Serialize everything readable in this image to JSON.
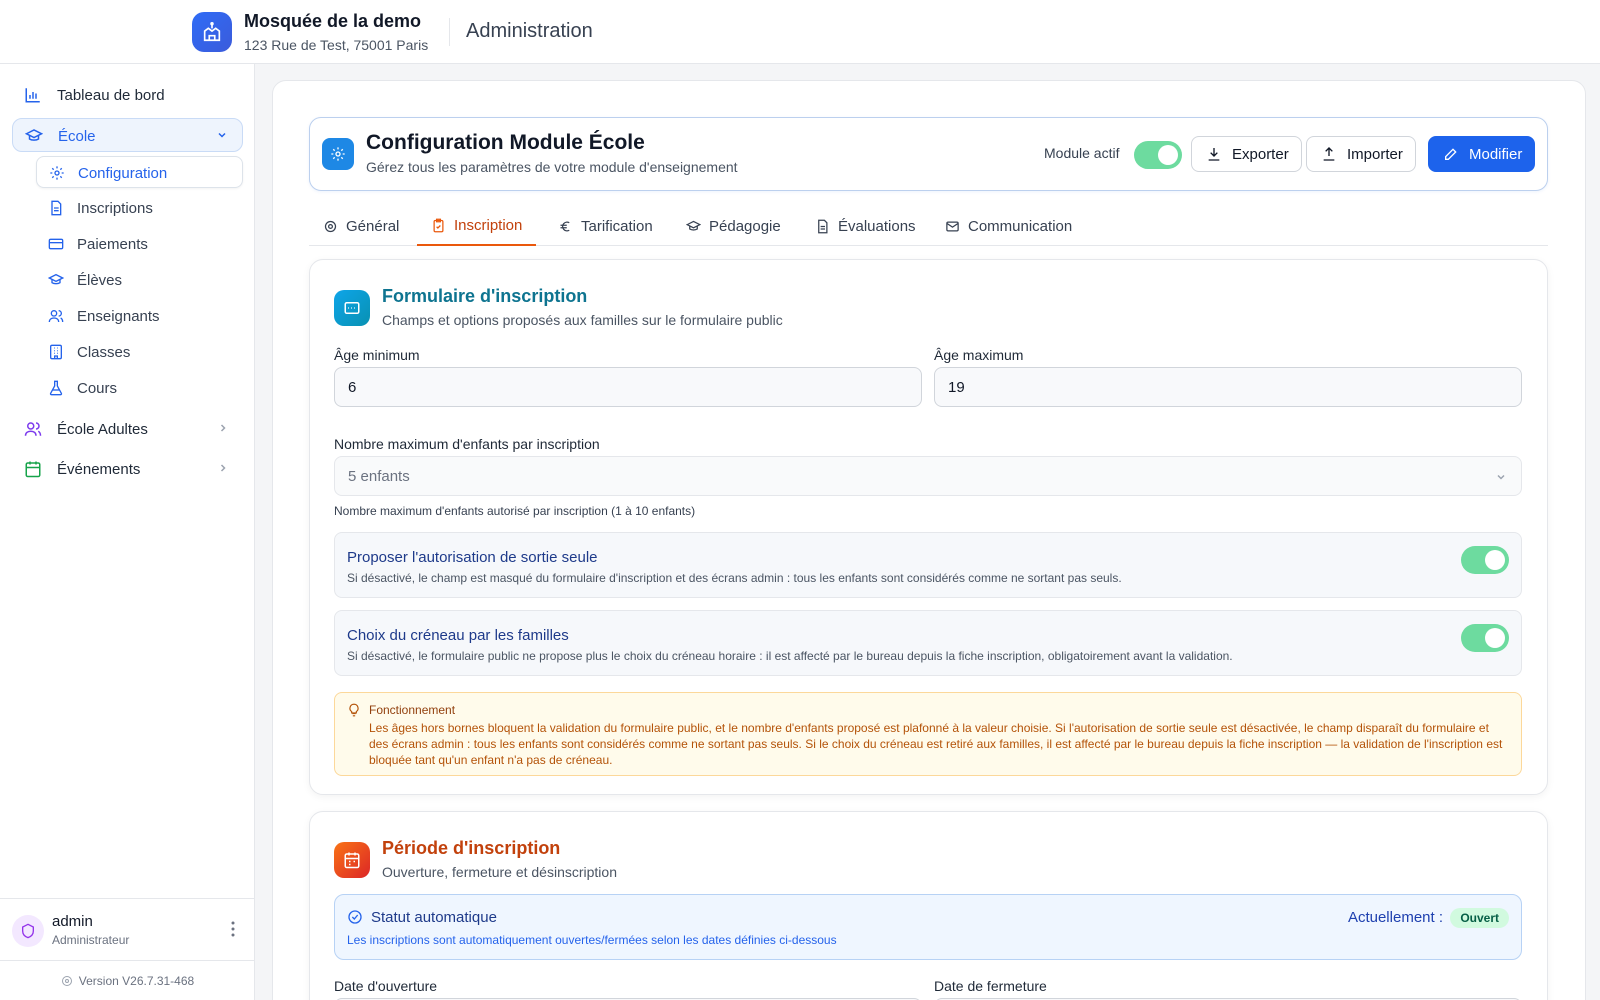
{
  "header": {
    "org_name": "Mosquée de la demo",
    "org_address": "123 Rue de Test, 75001 Paris",
    "section_title": "Administration"
  },
  "sidebar": {
    "items": [
      {
        "label": "Tableau de bord"
      },
      {
        "label": "École"
      },
      {
        "label": "École Adultes"
      },
      {
        "label": "Événements"
      }
    ],
    "sub_items": [
      {
        "label": "Configuration"
      },
      {
        "label": "Inscriptions"
      },
      {
        "label": "Paiements"
      },
      {
        "label": "Élèves"
      },
      {
        "label": "Enseignants"
      },
      {
        "label": "Classes"
      },
      {
        "label": "Cours"
      }
    ],
    "user": {
      "name": "admin",
      "role": "Administrateur"
    },
    "version": "Version V26.7.31-468"
  },
  "module": {
    "title": "Configuration Module École",
    "subtitle": "Gérez tous les paramètres de votre module d'enseignement",
    "active_label": "Module actif",
    "active": true,
    "export_label": "Exporter",
    "import_label": "Importer",
    "edit_label": "Modifier"
  },
  "tabs": [
    {
      "label": "Général",
      "active": false
    },
    {
      "label": "Inscription",
      "active": true
    },
    {
      "label": "Tarification",
      "active": false
    },
    {
      "label": "Pédagogie",
      "active": false
    },
    {
      "label": "Évaluations",
      "active": false
    },
    {
      "label": "Communication",
      "active": false
    }
  ],
  "form_section": {
    "title": "Formulaire d'inscription",
    "description": "Champs et options proposés aux familles sur le formulaire public",
    "age_min_label": "Âge minimum",
    "age_min_value": "6",
    "age_max_label": "Âge maximum",
    "age_max_value": "19",
    "max_children_label": "Nombre maximum d'enfants par inscription",
    "max_children_value": "5 enfants",
    "max_children_hint": "Nombre maximum d'enfants autorisé par inscription (1 à 10 enfants)",
    "option_exit": {
      "title": "Proposer l'autorisation de sortie seule",
      "description": "Si désactivé, le champ est masqué du formulaire d'inscription et des écrans admin : tous les enfants sont considérés comme ne sortant pas seuls.",
      "enabled": true
    },
    "option_slot": {
      "title": "Choix du créneau par les familles",
      "description": "Si désactivé, le formulaire public ne propose plus le choix du créneau horaire : il est affecté par le bureau depuis la fiche inscription, obligatoirement avant la validation.",
      "enabled": true
    },
    "info": {
      "title": "Fonctionnement",
      "text": "Les âges hors bornes bloquent la validation du formulaire public, et le nombre d'enfants proposé est plafonné à la valeur choisie. Si l'autorisation de sortie seule est désactivée, le champ disparaît du formulaire et des écrans admin : tous les enfants sont considérés comme ne sortant pas seuls. Si le choix du créneau est retiré aux familles, il est affecté par le bureau depuis la fiche inscription — la validation de l'inscription est bloquée tant qu'un enfant n'a pas de créneau."
    }
  },
  "period_section": {
    "title": "Période d'inscription",
    "description": "Ouverture, fermeture et désinscription",
    "status": {
      "title": "Statut automatique",
      "current_label": "Actuellement :",
      "current_value": "Ouvert",
      "description": "Les inscriptions sont automatiquement ouvertes/fermées selon les dates définies ci-dessous"
    },
    "open_date_label": "Date d'ouverture",
    "close_date_label": "Date de fermeture"
  },
  "colors": {
    "primary": "#1d63ec",
    "active_tab": "#ea580c",
    "toggle_on": "#6ddb9f",
    "form_title": "#0e7490",
    "period_title": "#c2410c"
  }
}
